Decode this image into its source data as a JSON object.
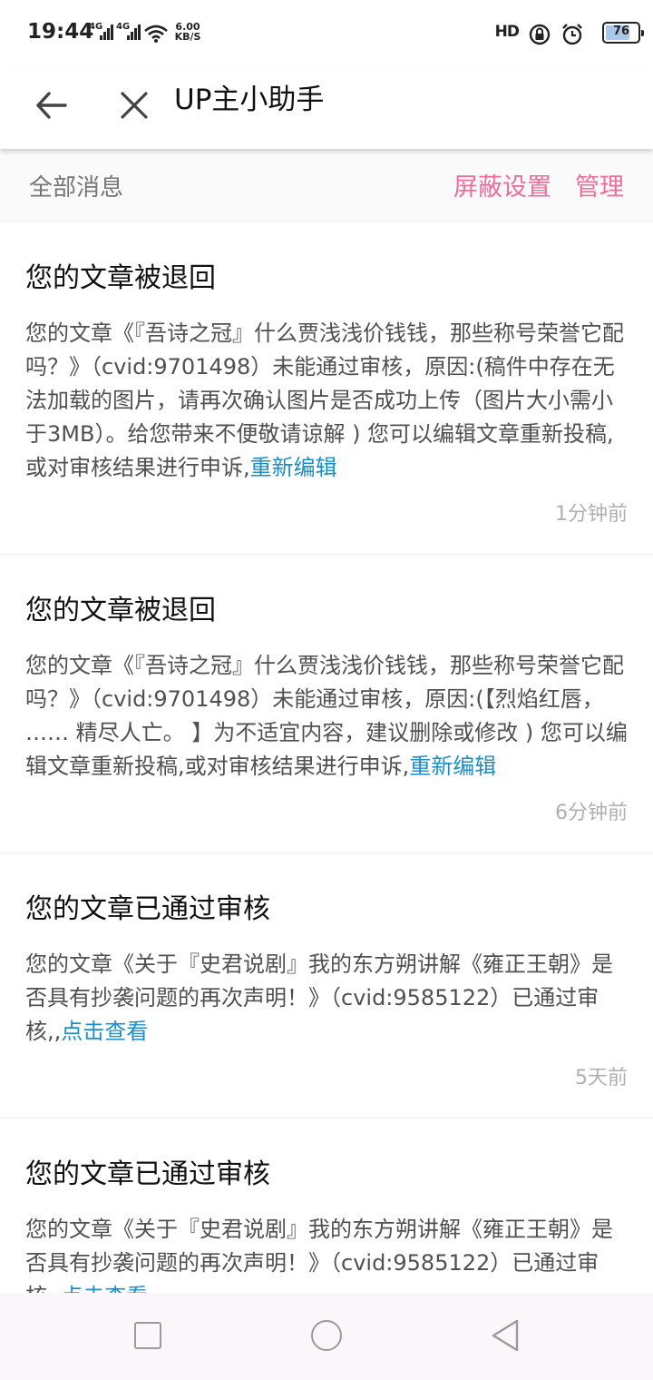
{
  "status_bar": {
    "time": "19:44",
    "signal1_label": "4G",
    "signal2_label": "4G",
    "speed_value": "6.00",
    "speed_unit": "KB/S",
    "hd_label": "HD",
    "battery_percent": "76",
    "battery_level": 0.76
  },
  "nav": {
    "title": "UP主小助手"
  },
  "sub_header": {
    "title": "全部消息",
    "block_settings": "屏蔽设置",
    "manage": "管理",
    "accent_color": "#ef6d98"
  },
  "link_color": "#1a8fc9",
  "messages": [
    {
      "title": "您的文章被退回",
      "body": "您的文章《『吾诗之冠』什么贾浅浅价钱钱，那些称号荣誉它配吗？》（cvid:9701498）未能通过审核，原因:(稿件中存在无法加载的图片，请再次确认图片是否成功上传（图片大小需小于3MB）。给您带来不便敬请谅解 ) 您可以编辑文章重新投稿,或对审核结果进行申诉,",
      "link": "重新编辑",
      "time": "1分钟前"
    },
    {
      "title": "您的文章被退回",
      "body": "您的文章《『吾诗之冠』什么贾浅浅价钱钱，那些称号荣誉它配吗？》（cvid:9701498）未能通过审核，原因:(【烈焰红唇， …… 精尽人亡。 】为不适宜内容，建议删除或修改 ) 您可以编辑文章重新投稿,或对审核结果进行申诉,",
      "link": "重新编辑",
      "time": "6分钟前"
    },
    {
      "title": "您的文章已通过审核",
      "body": "您的文章《关于『史君说剧』我的东方朔讲解《雍正王朝》是否具有抄袭问题的再次声明！》（cvid:9585122）已通过审核,,",
      "link": "点击查看",
      "time": "5天前"
    },
    {
      "title": "您的文章已通过审核",
      "body": "您的文章《关于『史君说剧』我的东方朔讲解《雍正王朝》是否具有抄袭问题的再次声明！》（cvid:9585122）已通过审核,,",
      "link": "点击查看",
      "time": ""
    }
  ]
}
